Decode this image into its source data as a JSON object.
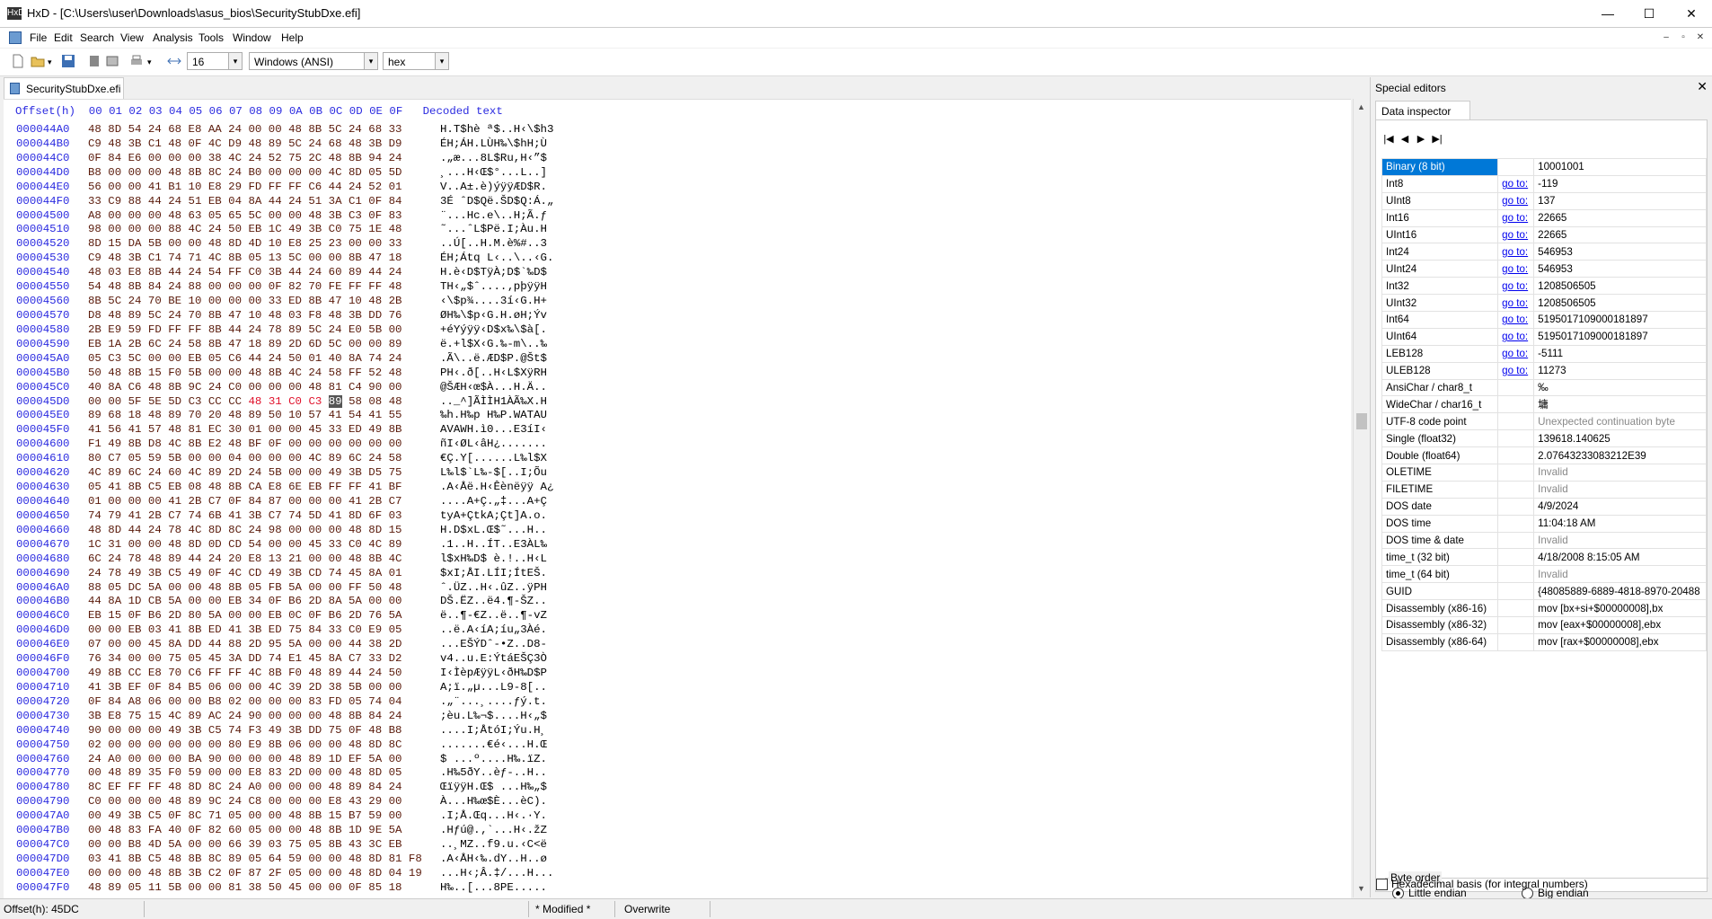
{
  "window": {
    "app_icon": "HxD",
    "title": "HxD - [C:\\Users\\user\\Downloads\\asus_bios\\SecurityStubDxe.efi]",
    "minimize": "—",
    "maximize": "☐",
    "close": "✕"
  },
  "menu": [
    "File",
    "Edit",
    "Search",
    "View",
    "Analysis",
    "Tools",
    "Window",
    "Help"
  ],
  "mdi_controls": [
    "–",
    "▫",
    "✕"
  ],
  "toolbar": {
    "bytes_per_row": "16",
    "charset": "Windows (ANSI)",
    "offset_base": "hex",
    "dropdown_arrow": "▾"
  },
  "document_tab": "SecurityStubDxe.efi",
  "hex_view": {
    "header": "Offset(h)  00 01 02 03 04 05 06 07 08 09 0A 0B 0C 0D 0E 0F   Decoded text",
    "rows": [
      {
        "o": "000044A0",
        "b": "48 8D 54 24 68 E8 AA 24 00 00 48 8B 5C 24 68 33",
        "d": "H.T$hè ª$..H‹\\$h3"
      },
      {
        "o": "000044B0",
        "b": "C9 48 3B C1 48 0F 4C D9 48 89 5C 24 68 48 3B D9",
        "d": "ÉH;ÁH.LÙH‰\\$hH;Ù"
      },
      {
        "o": "000044C0",
        "b": "0F 84 E6 00 00 00 38 4C 24 52 75 2C 48 8B 94 24",
        "d": ".„æ...8L$Ru,H‹”$"
      },
      {
        "o": "000044D0",
        "b": "B8 00 00 00 48 8B 8C 24 B0 00 00 00 4C 8D 05 5D",
        "d": "¸...H‹Œ$°...L..]"
      },
      {
        "o": "000044E0",
        "b": "56 00 00 41 B1 10 E8 29 FD FF FF C6 44 24 52 01",
        "d": "V..A±.è)ýÿÿÆD$R."
      },
      {
        "o": "000044F0",
        "b": "33 C9 88 44 24 51 EB 04 8A 44 24 51 3A C1 0F 84",
        "d": "3É ˆD$Që.ŠD$Q:Á.„"
      },
      {
        "o": "00004500",
        "b": "A8 00 00 00 48 63 05 65 5C 00 00 48 3B C3 0F 83",
        "d": "¨...Hc.e\\..H;Ã.ƒ"
      },
      {
        "o": "00004510",
        "b": "98 00 00 00 88 4C 24 50 EB 1C 49 3B C0 75 1E 48",
        "d": "˜...ˆL$Pë.I;Àu.H"
      },
      {
        "o": "00004520",
        "b": "8D 15 DA 5B 00 00 48 8D 4D 10 E8 25 23 00 00 33",
        "d": "..Ú[..H.M.è%#..3"
      },
      {
        "o": "00004530",
        "b": "C9 48 3B C1 74 71 4C 8B 05 13 5C 00 00 8B 47 18",
        "d": "ÉH;Átq L‹..\\..‹G."
      },
      {
        "o": "00004540",
        "b": "48 03 E8 8B 44 24 54 FF C0 3B 44 24 60 89 44 24",
        "d": "H.è‹D$TÿÀ;D$`‰D$"
      },
      {
        "o": "00004550",
        "b": "54 48 8B 84 24 88 00 00 00 0F 82 70 FE FF FF 48",
        "d": "TH‹„$ˆ....‚pþÿÿH"
      },
      {
        "o": "00004560",
        "b": "8B 5C 24 70 BE 10 00 00 00 33 ED 8B 47 10 48 2B",
        "d": "‹\\$p¾....3í‹G.H+"
      },
      {
        "o": "00004570",
        "b": "D8 48 89 5C 24 70 8B 47 10 48 03 F8 48 3B DD 76",
        "d": "ØH‰\\$p‹G.H.øH;Ýv"
      },
      {
        "o": "00004580",
        "b": "2B E9 59 FD FF FF 8B 44 24 78 89 5C 24 E0 5B 00",
        "d": "+éYýÿÿ‹D$x‰\\$à[."
      },
      {
        "o": "00004590",
        "b": "EB 1A 2B 6C 24 58 8B 47 18 89 2D 6D 5C 00 00 89",
        "d": "ë.+l$X‹G.‰-m\\..‰"
      },
      {
        "o": "000045A0",
        "b": "05 C3 5C 00 00 EB 05 C6 44 24 50 01 40 8A 74 24",
        "d": ".Ã\\..ë.ÆD$P.@Št$"
      },
      {
        "o": "000045B0",
        "b": "50 48 8B 15 F0 5B 00 00 48 8B 4C 24 58 FF 52 48",
        "d": "PH‹.ð[..H‹L$XÿRH"
      },
      {
        "o": "000045C0",
        "b": "40 8A C6 48 8B 9C 24 C0 00 00 00 48 81 C4 90 00",
        "d": "@ŠÆH‹œ$À...H.Ä.."
      },
      {
        "o": "000045D0",
        "b": "00 00 5F 5E 5D C3 CC CC 48 31 C0 C3 89 58 08 48",
        "d": ".._^]ÃÌÌH1ÀÃ‰X.H",
        "sel": [
          8,
          9,
          10,
          11
        ],
        "cur": 12
      },
      {
        "o": "000045E0",
        "b": "89 68 18 48 89 70 20 48 89 50 10 57 41 54 41 55",
        "d": "‰h.H‰p H‰P.WATAU"
      },
      {
        "o": "000045F0",
        "b": "41 56 41 57 48 81 EC 30 01 00 00 45 33 ED 49 8B",
        "d": "AVAWH.ì0...E3íI‹"
      },
      {
        "o": "00004600",
        "b": "F1 49 8B D8 4C 8B E2 48 BF 0F 00 00 00 00 00 00",
        "d": "ñI‹ØL‹âH¿......."
      },
      {
        "o": "00004610",
        "b": "80 C7 05 59 5B 00 00 04 00 00 00 4C 89 6C 24 58",
        "d": "€Ç.Y[......L‰l$X"
      },
      {
        "o": "00004620",
        "b": "4C 89 6C 24 60 4C 89 2D 24 5B 00 00 49 3B D5 75",
        "d": "L‰l$`L‰-$[..I;Õu"
      },
      {
        "o": "00004630",
        "b": "05 41 8B C5 EB 08 48 8B CA E8 6E EB FF FF 41 BF",
        "d": ".A‹Åë.H‹Êènëÿÿ A¿"
      },
      {
        "o": "00004640",
        "b": "01 00 00 00 41 2B C7 0F 84 87 00 00 00 41 2B C7",
        "d": "....A+Ç.„‡...A+Ç"
      },
      {
        "o": "00004650",
        "b": "74 79 41 2B C7 74 6B 41 3B C7 74 5D 41 8D 6F 03",
        "d": "tyA+ÇtkA;Çt]A.o."
      },
      {
        "o": "00004660",
        "b": "48 8D 44 24 78 4C 8D 8C 24 98 00 00 00 48 8D 15",
        "d": "H.D$xL.Œ$˜...H.."
      },
      {
        "o": "00004670",
        "b": "1C 31 00 00 48 8D 0D CD 54 00 00 45 33 C0 4C 89",
        "d": ".1..H..ÍT..E3ÀL‰"
      },
      {
        "o": "00004680",
        "b": "6C 24 78 48 89 44 24 20 E8 13 21 00 00 48 8B 4C",
        "d": "l$xH‰D$ è.!..H‹L"
      },
      {
        "o": "00004690",
        "b": "24 78 49 3B C5 49 0F 4C CD 49 3B CD 74 45 8A 01",
        "d": "$xI;ÅI.LÍI;ÍtEŠ."
      },
      {
        "o": "000046A0",
        "b": "88 05 DC 5A 00 00 48 8B 05 FB 5A 00 00 FF 50 48",
        "d": "ˆ.ÜZ..H‹.ûZ..ÿPH"
      },
      {
        "o": "000046B0",
        "b": "44 8A 1D CB 5A 00 00 EB 34 0F B6 2D 8A 5A 00 00",
        "d": "DŠ.ËZ..ë4.¶-ŠZ.."
      },
      {
        "o": "000046C0",
        "b": "EB 15 0F B6 2D 80 5A 00 00 EB 0C 0F B6 2D 76 5A",
        "d": "ë..¶-€Z..ë..¶-vZ"
      },
      {
        "o": "000046D0",
        "b": "00 00 EB 03 41 8B ED 41 3B ED 75 84 33 C0 E9 05",
        "d": "..ë.A‹íA;íu„3Àé."
      },
      {
        "o": "000046E0",
        "b": "07 00 00 45 8A DD 44 88 2D 95 5A 00 00 44 38 2D",
        "d": "...EŠÝDˆ-•Z..D8-"
      },
      {
        "o": "000046F0",
        "b": "76 34 00 00 75 05 45 3A DD 74 E1 45 8A C7 33 D2",
        "d": "v4..u.E:ÝtáEŠÇ3Ò"
      },
      {
        "o": "00004700",
        "b": "49 8B CC E8 70 C6 FF FF 4C 8B F0 48 89 44 24 50",
        "d": "I‹ÌèpÆÿÿL‹ðH‰D$P"
      },
      {
        "o": "00004710",
        "b": "41 3B EF 0F 84 B5 06 00 00 4C 39 2D 38 5B 00 00",
        "d": "A;ï.„µ...L9-8[.."
      },
      {
        "o": "00004720",
        "b": "0F 84 A8 06 00 00 B8 02 00 00 00 83 FD 05 74 04",
        "d": ".„¨...¸....ƒý.t."
      },
      {
        "o": "00004730",
        "b": "3B E8 75 15 4C 89 AC 24 90 00 00 00 48 8B 84 24",
        "d": ";èu.L‰¬$....H‹„$"
      },
      {
        "o": "00004740",
        "b": "90 00 00 00 49 3B C5 74 F3 49 3B DD 75 0F 48 B8",
        "d": "....I;ÅtóI;Ýu.H¸"
      },
      {
        "o": "00004750",
        "b": "02 00 00 00 00 00 00 80 E9 8B 06 00 00 48 8D 8C",
        "d": ".......€é‹...H.Œ"
      },
      {
        "o": "00004760",
        "b": "24 A0 00 00 00 BA 90 00 00 00 48 89 1D EF 5A 00",
        "d": "$ ...º....H‰.ïZ."
      },
      {
        "o": "00004770",
        "b": "00 48 89 35 F0 59 00 00 E8 83 2D 00 00 48 8D 05",
        "d": ".H‰5ðY..èƒ-..H.."
      },
      {
        "o": "00004780",
        "b": "8C EF FF FF 48 8D 8C 24 A0 00 00 00 48 89 84 24",
        "d": "ŒïÿÿH.Œ$ ...H‰„$"
      },
      {
        "o": "00004790",
        "b": "C0 00 00 00 48 89 9C 24 C8 00 00 00 E8 43 29 00",
        "d": "À...H‰œ$È...èC)."
      },
      {
        "o": "000047A0",
        "b": "00 49 3B C5 0F 8C 71 05 00 00 48 8B 15 B7 59 00",
        "d": ".I;Å.Œq...H‹.·Y."
      },
      {
        "o": "000047B0",
        "b": "00 48 83 FA 40 0F 82 60 05 00 00 48 8B 1D 9E 5A",
        "d": ".Hƒú@.‚`...H‹.žZ"
      },
      {
        "o": "000047C0",
        "b": "00 00 B8 4D 5A 00 00 66 39 03 75 05 8B 43 3C EB",
        "d": "..¸MZ..f9.u.‹C<ë"
      },
      {
        "o": "000047D0",
        "b": "03 41 8B C5 48 8B 8C 89 05 64 59 00 00 48 8D 81 F8",
        "d": ".A‹ÅH‹‰.dY..H..ø"
      },
      {
        "o": "000047E0",
        "b": "00 00 00 48 8B 3B C2 0F 87 2F 05 00 00 48 8D 04 19",
        "d": "...H‹;Â.‡/...H..."
      },
      {
        "o": "000047F0",
        "b": "48 89 05 11 5B 00 00 81 38 50 45 00 00 0F 85 18",
        "d": "H‰..[...8PE.....",
        "clip": true
      }
    ]
  },
  "scroll": {
    "up": "▲",
    "down": "▼"
  },
  "status": {
    "offset": "Offset(h): 45DC",
    "modified": "* Modified *",
    "mode": "Overwrite"
  },
  "special_editors": {
    "title": "Special editors",
    "close": "✕",
    "tab": "Data inspector",
    "nav": [
      "|◀",
      "◀",
      "▶",
      "▶|"
    ],
    "goto_label": "go to:",
    "rows": [
      {
        "name": "Binary (8 bit)",
        "value": "10001001",
        "highlight": true
      },
      {
        "name": "Int8",
        "goto": true,
        "value": "-119"
      },
      {
        "name": "UInt8",
        "goto": true,
        "value": "137"
      },
      {
        "name": "Int16",
        "goto": true,
        "value": "22665"
      },
      {
        "name": "UInt16",
        "goto": true,
        "value": "22665"
      },
      {
        "name": "Int24",
        "goto": true,
        "value": "546953"
      },
      {
        "name": "UInt24",
        "goto": true,
        "value": "546953"
      },
      {
        "name": "Int32",
        "goto": true,
        "value": "1208506505"
      },
      {
        "name": "UInt32",
        "goto": true,
        "value": "1208506505"
      },
      {
        "name": "Int64",
        "goto": true,
        "value": "5195017109000181897"
      },
      {
        "name": "UInt64",
        "goto": true,
        "value": "5195017109000181897"
      },
      {
        "name": "LEB128",
        "goto": true,
        "value": "-5111"
      },
      {
        "name": "ULEB128",
        "goto": true,
        "value": "11273"
      },
      {
        "name": "AnsiChar / char8_t",
        "value": "‰"
      },
      {
        "name": "WideChar / char16_t",
        "value": "墉"
      },
      {
        "name": "UTF-8 code point",
        "value": "Unexpected continuation byte",
        "invalid": true
      },
      {
        "name": "Single (float32)",
        "value": "139618.140625"
      },
      {
        "name": "Double (float64)",
        "value": "2.07643233083212E39"
      },
      {
        "name": "OLETIME",
        "value": "Invalid",
        "invalid": true
      },
      {
        "name": "FILETIME",
        "value": "Invalid",
        "invalid": true
      },
      {
        "name": "DOS date",
        "value": "4/9/2024"
      },
      {
        "name": "DOS time",
        "value": "11:04:18 AM"
      },
      {
        "name": "DOS time & date",
        "value": "Invalid",
        "invalid": true
      },
      {
        "name": "time_t (32 bit)",
        "value": "4/18/2008 8:15:05 AM"
      },
      {
        "name": "time_t (64 bit)",
        "value": "Invalid",
        "invalid": true
      },
      {
        "name": "GUID",
        "value": "{48085889-6889-4818-8970-20488"
      },
      {
        "name": "Disassembly (x86-16)",
        "value": "mov [bx+si+$00000008],bx"
      },
      {
        "name": "Disassembly (x86-32)",
        "value": "mov [eax+$00000008],ebx"
      },
      {
        "name": "Disassembly (x86-64)",
        "value": "mov [rax+$00000008],ebx"
      }
    ],
    "byte_order": {
      "label": "Byte order",
      "little": "Little endian",
      "big": "Big endian",
      "selected": "little"
    },
    "hex_basis": "Hexadecimal basis (for integral numbers)"
  }
}
